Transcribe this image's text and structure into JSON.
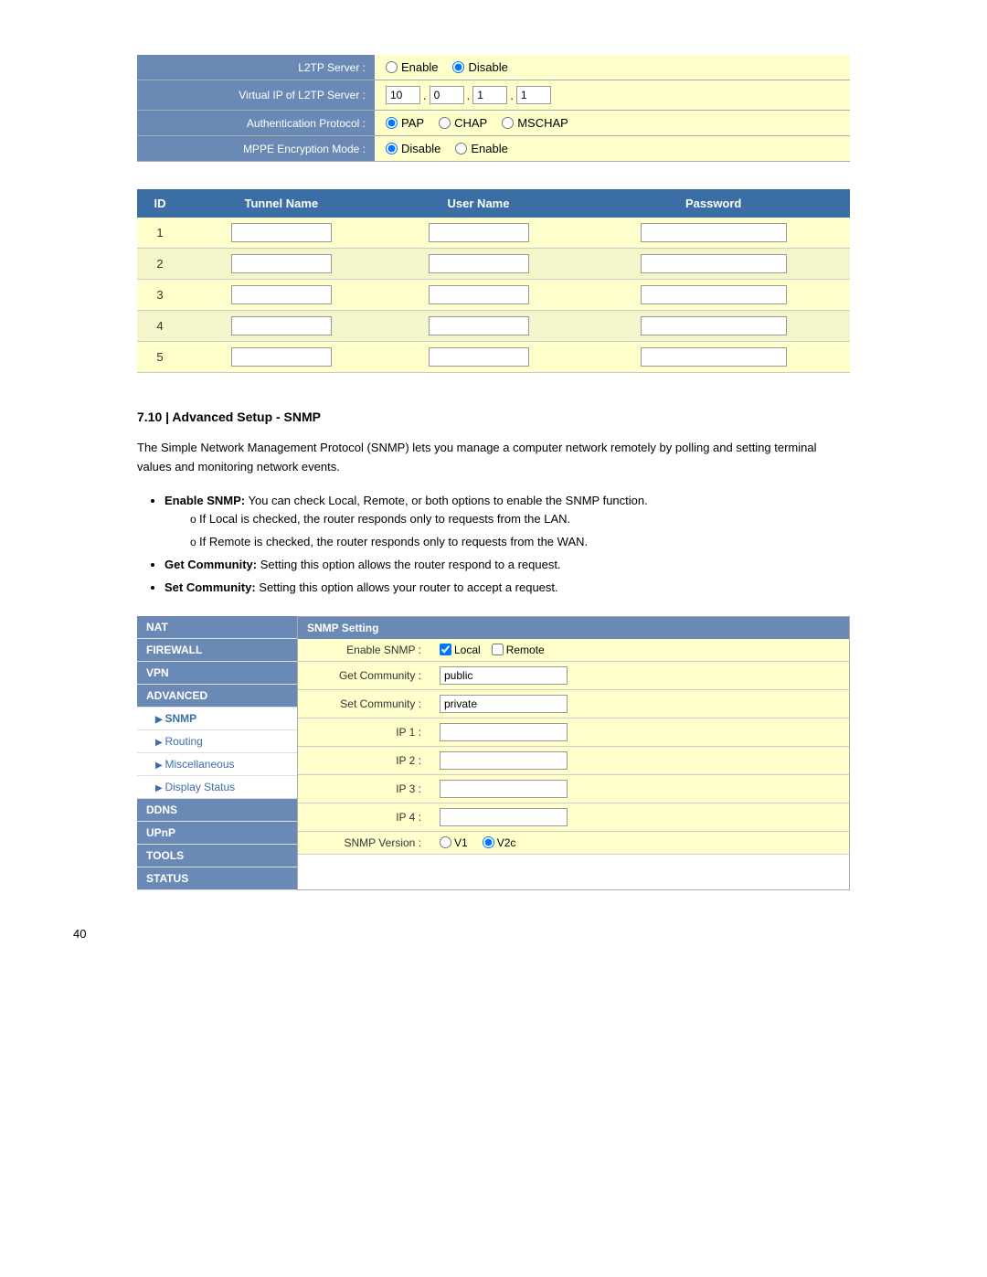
{
  "l2tp": {
    "server_label": "L2TP Server :",
    "virtual_ip_label": "Virtual IP of L2TP Server :",
    "auth_protocol_label": "Authentication Protocol :",
    "mppe_label": "MPPE Encryption Mode :",
    "enable_label": "Enable",
    "disable_label": "Disable",
    "ip_parts": [
      "10",
      "0",
      "1",
      "1"
    ],
    "pap_label": "PAP",
    "chap_label": "CHAP",
    "mschap_label": "MSCHAP",
    "mppe_disable": "Disable",
    "mppe_enable": "Enable"
  },
  "tunnel_table": {
    "col_id": "ID",
    "col_tunnel": "Tunnel Name",
    "col_user": "User Name",
    "col_password": "Password",
    "rows": [
      1,
      2,
      3,
      4,
      5
    ]
  },
  "section": {
    "heading": "7.10 | Advanced Setup - SNMP",
    "desc": "The Simple Network Management Protocol (SNMP) lets you manage a computer network remotely by polling and setting terminal values and monitoring network events.",
    "bullets": [
      {
        "text": "Enable SNMP: You can check Local, Remote, or both options to enable the SNMP function.",
        "sub": [
          "If Local is checked, the router responds only to requests from the LAN.",
          "If Remote is checked, the router responds only to requests from the WAN."
        ]
      },
      {
        "text": "Get Community: Setting this option allows the router respond to a request.",
        "sub": []
      },
      {
        "text": "Set Community: Setting this option allows your router to accept a request.",
        "sub": []
      }
    ]
  },
  "sidebar": {
    "items": [
      {
        "label": "NAT",
        "type": "header"
      },
      {
        "label": "FIREWALL",
        "type": "header"
      },
      {
        "label": "VPN",
        "type": "header"
      },
      {
        "label": "ADVANCED",
        "type": "header"
      },
      {
        "label": "SNMP",
        "type": "sub"
      },
      {
        "label": "Routing",
        "type": "sub"
      },
      {
        "label": "Miscellaneous",
        "type": "sub"
      },
      {
        "label": "Display Status",
        "type": "sub"
      },
      {
        "label": "DDNS",
        "type": "header"
      },
      {
        "label": "UPnP",
        "type": "header"
      },
      {
        "label": "TOOLS",
        "type": "header"
      },
      {
        "label": "STATUS",
        "type": "header"
      }
    ]
  },
  "snmp": {
    "panel_header": "SNMP Setting",
    "rows": [
      {
        "label": "Enable SNMP :",
        "type": "checkbox",
        "local": true,
        "remote": false
      },
      {
        "label": "Get Community :",
        "type": "text",
        "value": "public"
      },
      {
        "label": "Set Community :",
        "type": "text",
        "value": "private"
      },
      {
        "label": "IP 1 :",
        "type": "text",
        "value": ""
      },
      {
        "label": "IP 2 :",
        "type": "text",
        "value": ""
      },
      {
        "label": "IP 3 :",
        "type": "text",
        "value": ""
      },
      {
        "label": "IP 4 :",
        "type": "text",
        "value": ""
      },
      {
        "label": "SNMP Version :",
        "type": "radio",
        "v1": "V1",
        "v2c": "V2c",
        "selected": "V2c"
      }
    ],
    "local_label": "Local",
    "remote_label": "Remote"
  },
  "page_number": "40"
}
